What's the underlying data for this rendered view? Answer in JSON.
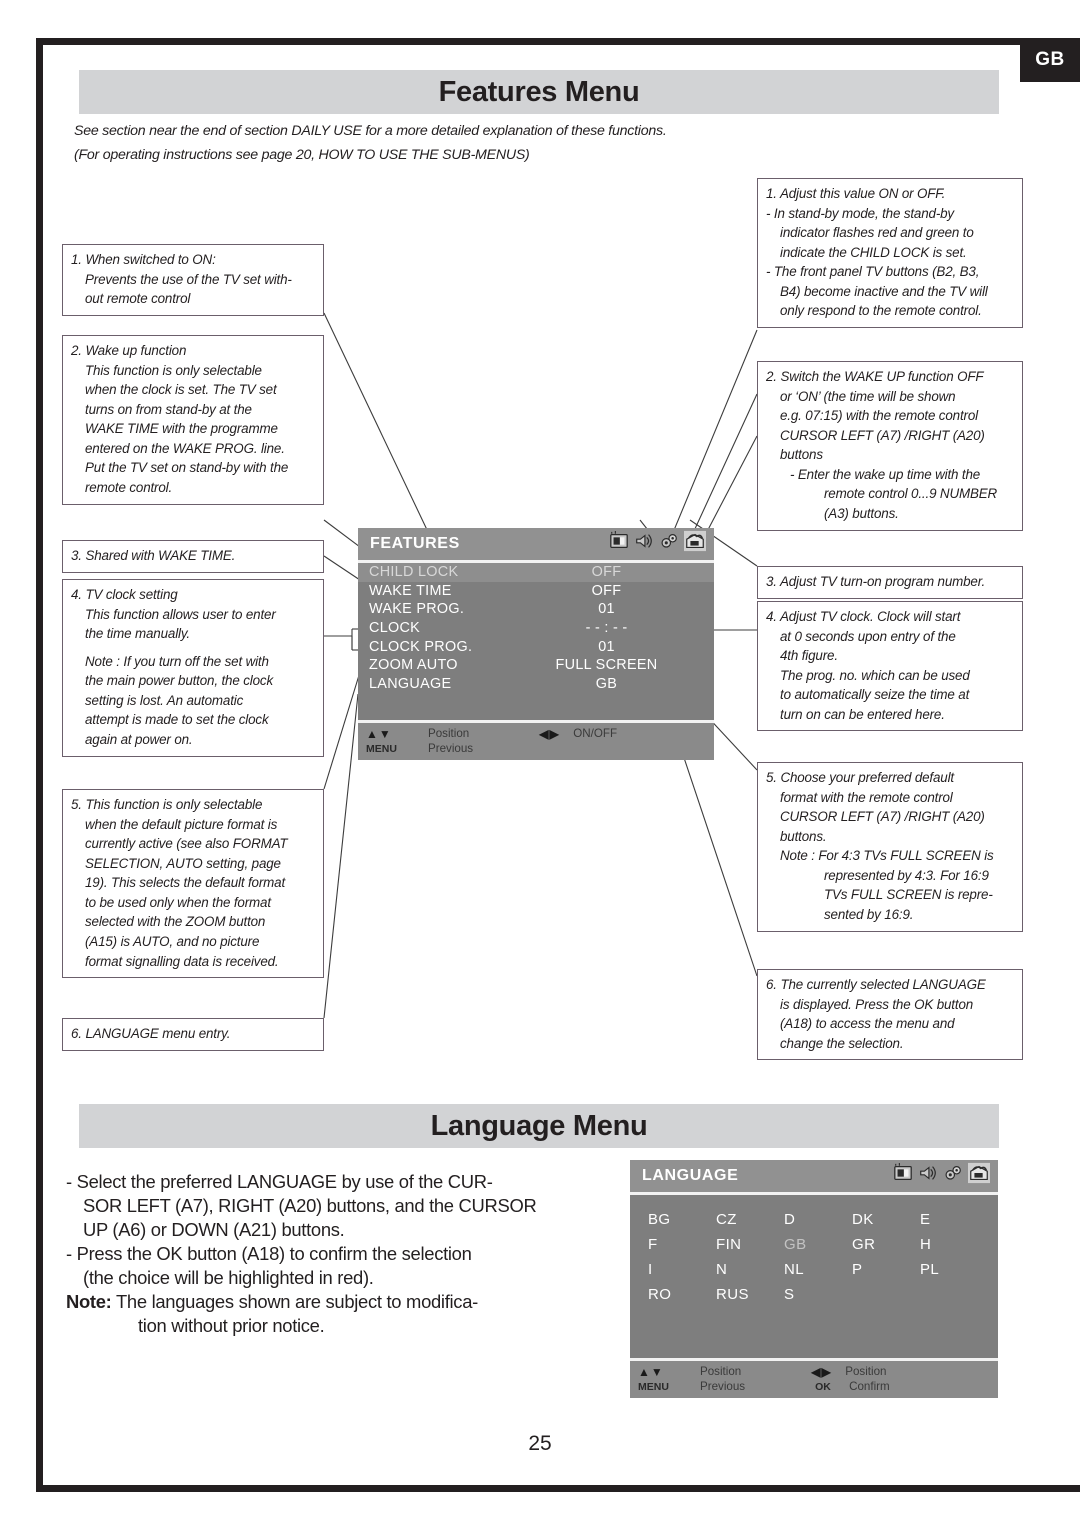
{
  "page": {
    "corner_tag": "GB",
    "number": "25"
  },
  "features_section": {
    "title": "Features Menu",
    "intro_line_1": "See section near the end of section DAILY USE for a more detailed explanation of these functions.",
    "intro_line_2": "(For operating instructions see page 20, HOW TO USE THE SUB-MENUS)"
  },
  "left_callouts": [
    {
      "id": "1",
      "lines": [
        {
          "text": "1. When switched to ON:",
          "indent": 0
        },
        {
          "text": "Prevents the use of the TV set with-",
          "indent": 1
        },
        {
          "text": "out remote control",
          "indent": 1
        }
      ]
    },
    {
      "id": "2",
      "lines": [
        {
          "text": "2. Wake up function",
          "indent": 0
        },
        {
          "text": "This function is only selectable",
          "indent": 1
        },
        {
          "text": "when the clock is set. The TV set",
          "indent": 1
        },
        {
          "text": "turns on from stand-by at the",
          "indent": 1
        },
        {
          "text": "WAKE TIME with the programme",
          "indent": 1
        },
        {
          "text": "entered on the WAKE PROG. line.",
          "indent": 1
        },
        {
          "text": "Put the TV set on stand-by with the",
          "indent": 1
        },
        {
          "text": "remote control.",
          "indent": 1
        }
      ]
    },
    {
      "id": "3",
      "lines": [
        {
          "text": "3. Shared with WAKE TIME.",
          "indent": 0
        }
      ]
    },
    {
      "id": "4",
      "lines": [
        {
          "text": "4. TV clock setting",
          "indent": 0
        },
        {
          "text": "This function allows user to enter",
          "indent": 1
        },
        {
          "text": "the time manually.",
          "indent": 1
        },
        {
          "text": "",
          "indent": 0
        },
        {
          "text": "Note : If you turn off the set with",
          "indent": 1
        },
        {
          "text": "the main power button, the clock",
          "indent": 1
        },
        {
          "text": "setting is lost. An automatic",
          "indent": 1
        },
        {
          "text": "attempt is made to set the clock",
          "indent": 1
        },
        {
          "text": "again at power on.",
          "indent": 1
        }
      ]
    },
    {
      "id": "5",
      "lines": [
        {
          "text": "5. This function is only selectable",
          "indent": 0
        },
        {
          "text": "when the default picture format is",
          "indent": 1
        },
        {
          "text": "currently active (see also FORMAT",
          "indent": 1
        },
        {
          "text": "SELECTION, AUTO setting, page",
          "indent": 1
        },
        {
          "text": "19). This selects the default format",
          "indent": 1
        },
        {
          "text": "to be used only when the format",
          "indent": 1
        },
        {
          "text": "selected with the ZOOM button",
          "indent": 1
        },
        {
          "text": "(A15) is AUTO, and no picture",
          "indent": 1
        },
        {
          "text": "format signalling data is received.",
          "indent": 1
        }
      ]
    },
    {
      "id": "6",
      "lines": [
        {
          "text": "6. LANGUAGE menu entry.",
          "indent": 0
        }
      ]
    }
  ],
  "right_callouts": [
    {
      "id": "1",
      "lines": [
        {
          "text": "1. Adjust this value ON or OFF.",
          "indent": 0
        },
        {
          "text": "- In stand-by mode, the stand-by",
          "indent": 0
        },
        {
          "text": "indicator flashes red and green to",
          "indent": 1
        },
        {
          "text": "indicate the CHILD LOCK is set.",
          "indent": 1
        },
        {
          "text": "- The front panel TV buttons (B2, B3,",
          "indent": 0
        },
        {
          "text": "B4) become inactive and the TV will",
          "indent": 1
        },
        {
          "text": "only respond to the remote control.",
          "indent": 1
        }
      ]
    },
    {
      "id": "2",
      "lines": [
        {
          "text": "2. Switch the WAKE UP function OFF",
          "indent": 0
        },
        {
          "text": "or ‘ON’ (the time will be shown",
          "indent": 1
        },
        {
          "text": "e.g. 07:15) with the remote control",
          "indent": 1
        },
        {
          "text": "CURSOR LEFT (A7) /RIGHT (A20)",
          "indent": 1
        },
        {
          "text": "buttons",
          "indent": 1
        },
        {
          "text": "- Enter the wake up time with the",
          "indent": 2
        },
        {
          "text": "remote control 0...9 NUMBER",
          "indent": 3
        },
        {
          "text": "(A3) buttons.",
          "indent": 3
        }
      ]
    },
    {
      "id": "3",
      "lines": [
        {
          "text": "3. Adjust TV turn-on program number.",
          "indent": 0
        }
      ]
    },
    {
      "id": "4",
      "lines": [
        {
          "text": "4. Adjust TV clock. Clock will start",
          "indent": 0
        },
        {
          "text": "at 0 seconds upon entry of the",
          "indent": 1
        },
        {
          "text": "4th figure.",
          "indent": 1
        },
        {
          "text": "The prog. no. which can be used",
          "indent": 1
        },
        {
          "text": "to automatically seize the time at",
          "indent": 1
        },
        {
          "text": "turn on can be entered here.",
          "indent": 1
        }
      ]
    },
    {
      "id": "5",
      "lines": [
        {
          "text": "5. Choose your preferred default",
          "indent": 0
        },
        {
          "text": "format with the remote control",
          "indent": 1
        },
        {
          "text": "CURSOR LEFT (A7) /RIGHT (A20)",
          "indent": 1
        },
        {
          "text": "buttons.",
          "indent": 1
        },
        {
          "text": "Note : For 4:3 TVs FULL SCREEN is",
          "indent": 1
        },
        {
          "text": "represented by 4:3. For 16:9",
          "indent": 3
        },
        {
          "text": "TVs FULL SCREEN is repre-",
          "indent": 3
        },
        {
          "text": "sented by 16:9.",
          "indent": 3
        }
      ]
    },
    {
      "id": "6",
      "lines": [
        {
          "text": "6. The currently selected LANGUAGE",
          "indent": 0
        },
        {
          "text": "is displayed. Press the OK button",
          "indent": 1
        },
        {
          "text": "(A18) to access the menu and",
          "indent": 1
        },
        {
          "text": "change the selection.",
          "indent": 1
        }
      ]
    }
  ],
  "features_osd": {
    "title": "FEATURES",
    "icons": [
      "picture-icon",
      "sound-icon",
      "install-icon",
      "features-icon"
    ],
    "rows": [
      {
        "label": "CHILD LOCK",
        "value": "OFF",
        "selected": true
      },
      {
        "label": "WAKE TIME",
        "value": "OFF",
        "selected": false
      },
      {
        "label": "WAKE PROG.",
        "value": "01",
        "selected": false
      },
      {
        "label": "CLOCK",
        "value": "- - : - -",
        "selected": false
      },
      {
        "label": "CLOCK PROG.",
        "value": "01",
        "selected": false
      },
      {
        "label": "ZOOM AUTO",
        "value": "FULL SCREEN",
        "selected": false
      },
      {
        "label": "LANGUAGE",
        "value": "GB",
        "selected": false
      }
    ],
    "footer": {
      "up_down_key": "▲▼",
      "up_down_action": "Position",
      "left_right_key": "◀▶",
      "left_right_action": "ON/OFF",
      "menu_key": "MENU",
      "menu_action": "Previous"
    }
  },
  "language_section": {
    "title": "Language Menu",
    "copy": [
      {
        "text": "- Select the preferred LANGUAGE by use of the CUR-",
        "style": "normal"
      },
      {
        "text": "SOR LEFT (A7), RIGHT (A20) buttons, and the CURSOR",
        "style": "hang"
      },
      {
        "text": "UP (A6) or DOWN (A21) buttons.",
        "style": "hang"
      },
      {
        "text": "- Press the OK button (A18) to confirm the selection",
        "style": "normal"
      },
      {
        "text": "(the choice will be highlighted in red).",
        "style": "hang"
      }
    ],
    "note_label": "Note:",
    "note_line_1": " The languages shown are subject to modifica-",
    "note_line_2": "tion without prior notice."
  },
  "language_osd": {
    "title": "LANGUAGE",
    "icons": [
      "picture-icon",
      "sound-icon",
      "install-icon",
      "features-icon"
    ],
    "grid": [
      {
        "code": "BG",
        "dim": false
      },
      {
        "code": "CZ",
        "dim": false
      },
      {
        "code": "D",
        "dim": false
      },
      {
        "code": "DK",
        "dim": false
      },
      {
        "code": "E",
        "dim": false
      },
      {
        "code": "F",
        "dim": false
      },
      {
        "code": "FIN",
        "dim": false
      },
      {
        "code": "GB",
        "dim": true
      },
      {
        "code": "GR",
        "dim": false
      },
      {
        "code": "H",
        "dim": false
      },
      {
        "code": "I",
        "dim": false
      },
      {
        "code": "N",
        "dim": false
      },
      {
        "code": "NL",
        "dim": false
      },
      {
        "code": "P",
        "dim": false
      },
      {
        "code": "PL",
        "dim": false
      },
      {
        "code": "RO",
        "dim": false
      },
      {
        "code": "RUS",
        "dim": false
      },
      {
        "code": "S",
        "dim": false
      },
      {
        "code": "",
        "dim": false
      },
      {
        "code": "",
        "dim": false
      }
    ],
    "footer": {
      "up_down_key": "▲▼",
      "up_down_action": "Position",
      "left_right_key": "◀▶",
      "left_right_action": "Position",
      "menu_key": "MENU",
      "menu_action": "Previous",
      "ok_key": "OK",
      "ok_action": "Confirm"
    }
  },
  "colors": {
    "frame": "#231f20",
    "section_bar": "#d2d3d5",
    "osd_body": "#7e7e7e",
    "osd_header": "#919191",
    "osd_selected_row": "#8e8e8e"
  }
}
